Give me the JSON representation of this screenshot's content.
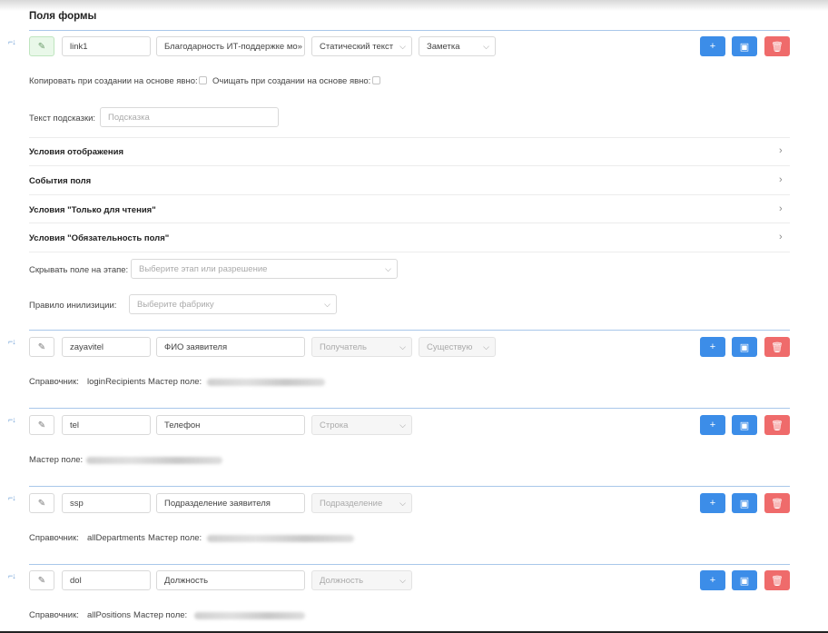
{
  "title": "Поля формы",
  "fields": [
    {
      "code": "link1",
      "name": "Благодарность ИТ-поддержке мо»",
      "type": "Статический текст",
      "subtype": "Заметка"
    },
    {
      "code": "zayavitel",
      "name": "ФИО заявителя",
      "type": "Получатель",
      "subtype": "Существую",
      "directory_label": "Справочник:",
      "directory": "loginRecipients",
      "master_label": "Мастер поле:"
    },
    {
      "code": "tel",
      "name": "Телефон",
      "type": "Строка",
      "master_label": "Мастер поле:"
    },
    {
      "code": "ssp",
      "name": "Подразделение заявителя",
      "type": "Подразделение",
      "directory_label": "Справочник:",
      "directory": "allDepartments",
      "master_label": "Мастер поле:"
    },
    {
      "code": "dol",
      "name": "Должность",
      "type": "Должность",
      "directory_label": "Справочник:",
      "directory": "allPositions",
      "master_label": "Мастер поле:"
    }
  ],
  "details": {
    "copy_label": "Копировать при создании на основе явно:",
    "clear_label": "Очищать при создании на основе явно:",
    "hint_label": "Текст подсказки:",
    "hint_placeholder": "Подсказка",
    "sections": [
      "Условия отображения",
      "События поля",
      "Условия \"Только для чтения\"",
      "Условия \"Обязательность поля\""
    ],
    "hide_label": "Скрывать поле на этапе:",
    "hide_placeholder": "Выберите этап или разрешение",
    "init_label": "Правило инилизиции:",
    "init_placeholder": "Выберите фабрику"
  },
  "icons": {
    "drag": "drag-handle-icon",
    "edit": "pencil-icon",
    "add": "plus-icon",
    "config": "edit-square-icon",
    "delete": "trash-icon",
    "chevron": "chevron-down-icon",
    "arrow": "chevron-right-icon"
  },
  "colors": {
    "primary": "#3c8de8",
    "danger": "#ef6b6b",
    "active_edit": "#e9f8e9"
  }
}
